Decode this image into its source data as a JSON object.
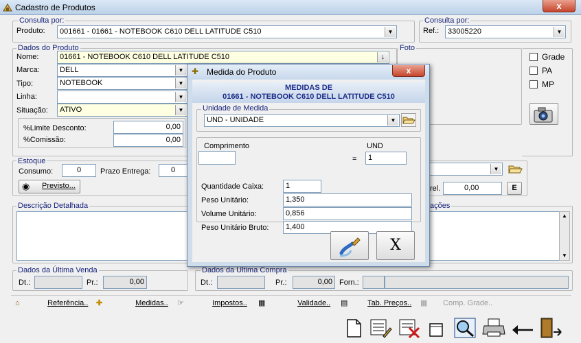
{
  "window": {
    "title": "Cadastro de Produtos",
    "close": "x"
  },
  "consulta_por": {
    "legend": "Consulta por:",
    "produto_label": "Produto:",
    "produto_value": "001661 - 01661 - NOTEBOOK  C610    DELL  LATITUDE C510",
    "legend2": "Consulta por:",
    "ref_label": "Ref.:",
    "ref_value": "33005220"
  },
  "dados_produto": {
    "legend": "Dados do Produto",
    "nome_label": "Nome:",
    "nome_value": "01661 - NOTEBOOK  C610    DELL  LATITUDE C510",
    "marca_label": "Marca:",
    "marca_value": "DELL",
    "tipo_label": "Tipo:",
    "tipo_value": "NOTEBOOK",
    "linha_label": "Linha:",
    "linha_value": "",
    "situacao_label": "Situação:",
    "situacao_value": "ATIVO",
    "limite_label": "%Limite Desconto:",
    "limite_value": "0,00",
    "comissao_label": "%Comissão:",
    "comissao_value": "0,00"
  },
  "foto": {
    "legend": "Foto",
    "grade": "Grade",
    "pa": "PA",
    "mp": "MP"
  },
  "estoque": {
    "legend": "Estoque",
    "consumo_label": "Consumo:",
    "consumo_value": "0",
    "prazo_label": "Prazo Entrega:",
    "prazo_value": "0",
    "previsto_label": "Previsto...",
    "rel_label": "rel.",
    "rel_value": "0,00",
    "e_label": "E"
  },
  "descricao": {
    "legend": "Descrição Detalhada",
    "obs_legend": "ações"
  },
  "ultima_venda": {
    "legend": "Dados da Última Venda",
    "dt_label": "Dt.:",
    "pr_label": "Pr.:",
    "pr_value": "0,00"
  },
  "ultima_compra": {
    "legend": "Dados da Última Compra",
    "dt_label": "Dt.:",
    "pr_label": "Pr.:",
    "pr_value": "0,00",
    "forn_label": "Forn.:"
  },
  "toolbar": {
    "referencia": "Referência..",
    "medidas": "Medidas..",
    "impostos": "Impostos..",
    "validade": "Validade..",
    "tab_precos": "Tab. Preços..",
    "comp_grade": "Comp. Grade.."
  },
  "dialog": {
    "title": "Medida do Produto",
    "close": "x",
    "banner_line1": "MEDIDAS DE",
    "banner_line2": "01661 - NOTEBOOK  C610      DELL  LATITUDE C510",
    "unidade_legend": "Unidade de Medida",
    "unidade_value": "UND  - UNIDADE",
    "comprimento_label": "Comprimento",
    "und_label": "UND",
    "equals": "=",
    "und_value": "1",
    "qtd_caixa_label": "Quantidade Caixa:",
    "qtd_caixa_value": "1",
    "peso_label": "Peso Unitário:",
    "peso_value": "1,350",
    "volume_label": "Volume Unitário:",
    "volume_value": "0,856",
    "peso_bruto_label": "Peso Unitário Bruto:",
    "peso_bruto_value": "1,400",
    "cancel_label": "X"
  }
}
